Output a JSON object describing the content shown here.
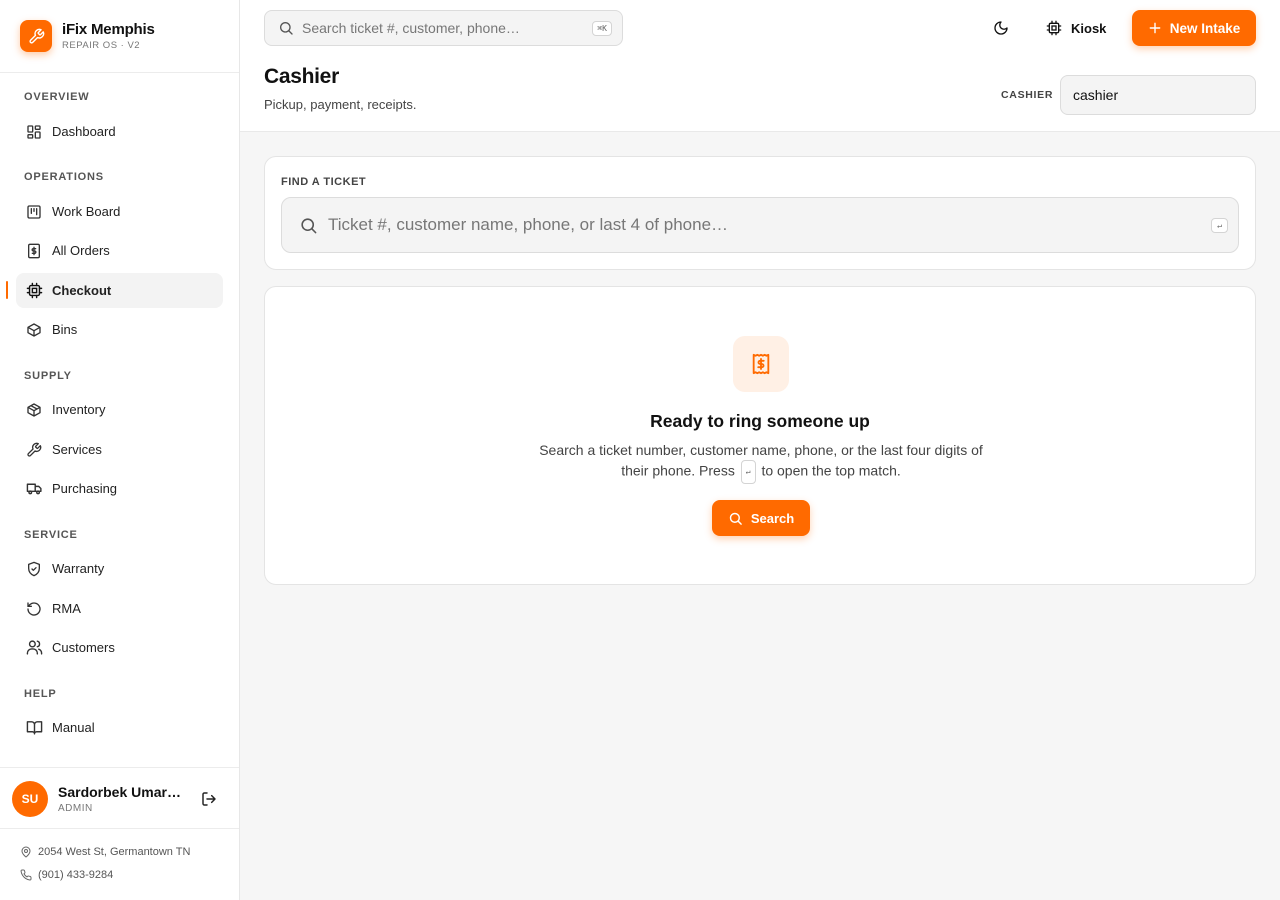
{
  "brand": {
    "name": "iFix Memphis",
    "subtitle": "REPAIR OS · V2",
    "icon": "wrench-icon"
  },
  "sidebar": {
    "sections": [
      {
        "label": "OVERVIEW"
      },
      {
        "label": "OPERATIONS"
      },
      {
        "label": "SUPPLY"
      },
      {
        "label": "SERVICE"
      },
      {
        "label": "HELP"
      }
    ],
    "items": [
      {
        "label": "Dashboard",
        "icon": "dashboard-icon"
      },
      {
        "label": "Work Board",
        "icon": "board-icon"
      },
      {
        "label": "All Orders",
        "icon": "dollar-receipt-icon"
      },
      {
        "label": "Checkout",
        "icon": "chip-icon",
        "active": true
      },
      {
        "label": "Bins",
        "icon": "box-icon"
      },
      {
        "label": "Inventory",
        "icon": "package-icon"
      },
      {
        "label": "Services",
        "icon": "wrench-icon"
      },
      {
        "label": "Purchasing",
        "icon": "truck-icon"
      },
      {
        "label": "Warranty",
        "icon": "shield-check-icon"
      },
      {
        "label": "RMA",
        "icon": "rotate-ccw-icon"
      },
      {
        "label": "Customers",
        "icon": "users-icon"
      },
      {
        "label": "Manual",
        "icon": "book-icon"
      }
    ]
  },
  "user": {
    "initials": "SU",
    "name": "Sardorbek Umarov",
    "role": "ADMIN"
  },
  "store": {
    "address": "2054 West St, Germantown TN",
    "phone": "(901) 433-9284"
  },
  "topbar": {
    "search_placeholder": "Search ticket #, customer, phone…",
    "search_shortcut": "⌘K",
    "kiosk_label": "Kiosk",
    "new_intake_label": "New Intake"
  },
  "page": {
    "title": "Cashier",
    "subtitle": "Pickup, payment, receipts.",
    "cashier_label": "CASHIER",
    "cashier_value": "cashier"
  },
  "find": {
    "label": "FIND A TICKET",
    "placeholder": "Ticket #, customer name, phone, or last 4 of phone…",
    "shortcut": "↵"
  },
  "empty": {
    "title": "Ready to ring someone up",
    "desc_before": "Search a ticket number, customer name, phone, or the last four digits of their phone. Press",
    "desc_key": "↵",
    "desc_after": "to open the top match.",
    "button_label": "Search"
  },
  "colors": {
    "accent": "#ff6a00",
    "accent_soft": "#fff0e5"
  }
}
